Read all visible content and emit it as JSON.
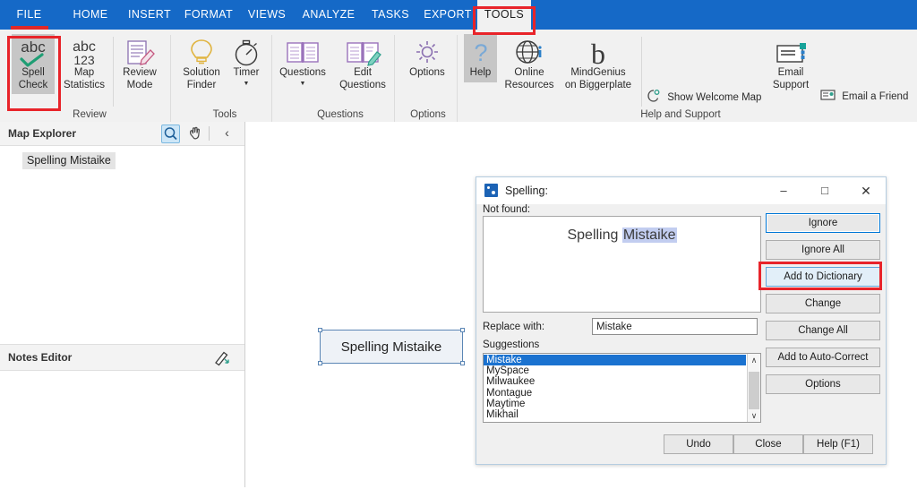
{
  "ribbon": {
    "tabs": [
      {
        "label": "FILE",
        "active": false,
        "underline": true
      },
      {
        "label": "HOME",
        "active": false,
        "underline": false
      },
      {
        "label": "INSERT",
        "active": false,
        "underline": false
      },
      {
        "label": "FORMAT",
        "active": false,
        "underline": false
      },
      {
        "label": "VIEWS",
        "active": false,
        "underline": false
      },
      {
        "label": "ANALYZE",
        "active": false,
        "underline": false
      },
      {
        "label": "TASKS",
        "active": false,
        "underline": false
      },
      {
        "label": "EXPORT",
        "active": false,
        "underline": false
      },
      {
        "label": "TOOLS",
        "active": true,
        "underline": false
      }
    ],
    "commands": {
      "spell_check": "Spell\nCheck",
      "map_statistics": "Map\nStatistics",
      "review_mode": "Review\nMode",
      "solution_finder": "Solution\nFinder",
      "timer": "Timer",
      "questions": "Questions",
      "edit_questions": "Edit\nQuestions",
      "options": "Options",
      "help": "Help",
      "online_resources": "Online\nResources",
      "mindgenius_biggerplate": "MindGenius\non Biggerplate",
      "show_welcome_map": "Show Welcome Map",
      "email_support": "Email\nSupport",
      "email_a_friend": "Email a Friend"
    },
    "groups": {
      "review": "Review",
      "tools": "Tools",
      "questions": "Questions",
      "options": "Options",
      "help_and_support": "Help and Support"
    },
    "icons": {
      "spell_check": "abc-check-icon",
      "map_statistics": "abc-123-icon",
      "review_mode": "notepad-pencil-icon",
      "solution_finder": "lightbulb-icon",
      "timer": "stopwatch-icon",
      "questions": "open-book-icon",
      "edit_questions": "open-book-pencil-icon",
      "options": "gear-icon",
      "help": "question-mark-icon",
      "online_resources": "globe-icon",
      "mindgenius_biggerplate": "biggerplate-b-icon",
      "show_welcome_map": "welcome-map-icon",
      "email_support": "envelope-icon",
      "email_a_friend": "email-friend-icon"
    },
    "glyphs": {
      "abc": "abc",
      "num": "123",
      "letter_b": "b"
    }
  },
  "left_panel": {
    "map_explorer_title": "Map Explorer",
    "notes_editor_title": "Notes Editor",
    "tree_items": [
      "Spelling Mistaike"
    ],
    "buttons": {
      "search": "search-icon",
      "pan": "hand-icon",
      "collapse": "chevron-left-icon",
      "collapse_glyph": "‹",
      "notes_edit": "pencil-icon"
    }
  },
  "canvas": {
    "node_label": "Spelling Mistaike"
  },
  "dialog": {
    "title": "Spelling:",
    "window_buttons": {
      "minimize": "–",
      "maximize": "□",
      "close": "✕"
    },
    "not_found_label": "Not found:",
    "not_found_prefix": "Spelling ",
    "not_found_word": "Mistaike",
    "replace_with_label": "Replace with:",
    "replace_with_value": "Mistake",
    "suggestions_label": "Suggestions",
    "suggestions": [
      "Mistake",
      "MySpace",
      "Milwaukee",
      "Montague",
      "Maytime",
      "Mikhail"
    ],
    "selected_suggestion": "Mistake",
    "action_buttons": [
      {
        "label": "Ignore",
        "state": "focus"
      },
      {
        "label": "Ignore All",
        "state": "normal"
      },
      {
        "label": "Add to Dictionary",
        "state": "hover"
      },
      {
        "label": "Change",
        "state": "normal"
      },
      {
        "label": "Change All",
        "state": "normal"
      },
      {
        "label": "Add to Auto-Correct",
        "state": "normal"
      },
      {
        "label": "Options",
        "state": "normal"
      }
    ],
    "footer_buttons": [
      "Undo",
      "Close",
      "Help (F1)"
    ],
    "scroll_up_glyph": "∧",
    "scroll_down_glyph": "∨"
  },
  "annotations": {
    "tools_tab": "red-highlight-box",
    "spell_check": "red-highlight-box",
    "add_to_dictionary": "red-highlight-box"
  },
  "colors": {
    "ribbon_blue": "#1569c7",
    "annotation_red": "#e8242a",
    "selection_blue": "#1a72d0",
    "highlight_lavender": "#c2cdf0",
    "ribbon_face": "#f1f1f1"
  }
}
